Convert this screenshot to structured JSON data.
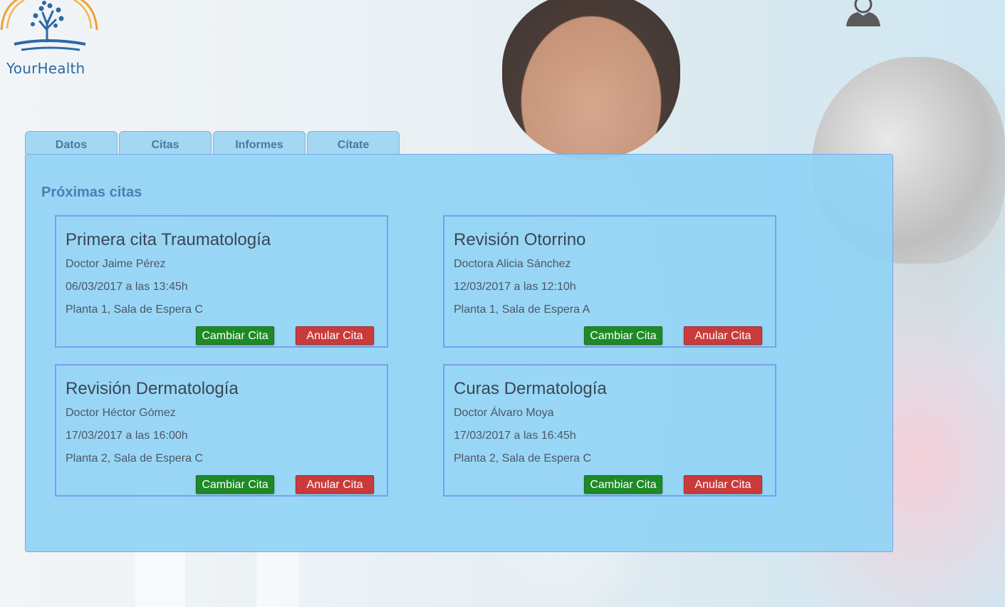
{
  "app": {
    "logo_text": "YourHealth"
  },
  "tabs": [
    {
      "label": "Datos"
    },
    {
      "label": "Citas"
    },
    {
      "label": "Informes"
    },
    {
      "label": "Cítate"
    }
  ],
  "panel": {
    "title": "Próximas citas"
  },
  "appointments": [
    {
      "title": "Primera cita Traumatología",
      "doctor": "Doctor Jaime Pérez",
      "datetime": "06/03/2017 a las 13:45h",
      "location": "Planta 1, Sala de Espera C",
      "change_label": "Cambiar Cita",
      "cancel_label": "Anular Cita"
    },
    {
      "title": "Revisión Otorrino",
      "doctor": "Doctora Alicia Sánchez",
      "datetime": "12/03/2017 a las 12:10h",
      "location": "Planta 1, Sala de Espera A",
      "change_label": "Cambiar Cita",
      "cancel_label": "Anular Cita"
    },
    {
      "title": "Revisión Dermatología",
      "doctor": "Doctor Héctor Gómez",
      "datetime": "17/03/2017 a las 16:00h",
      "location": "Planta 2, Sala de Espera C",
      "change_label": "Cambiar Cita",
      "cancel_label": "Anular Cita"
    },
    {
      "title": "Curas Dermatología",
      "doctor": "Doctor Álvaro Moya",
      "datetime": "17/03/2017 a las 16:45h",
      "location": "Planta 2, Sala de Espera C",
      "change_label": "Cambiar Cita",
      "cancel_label": "Anular Cita"
    }
  ],
  "colors": {
    "tab_bg": "#a4d7f1",
    "tab_text": "#4a78a4",
    "panel_bg": "#8fd3f5",
    "card_border": "#7b9ef0",
    "change_button": "#1e8a26",
    "cancel_button": "#c93b3b",
    "logo_blue": "#2a6aa8",
    "logo_orange": "#f0a030"
  },
  "icons": {
    "logo": "tree-logo-icon",
    "user": "user-avatar-icon"
  }
}
